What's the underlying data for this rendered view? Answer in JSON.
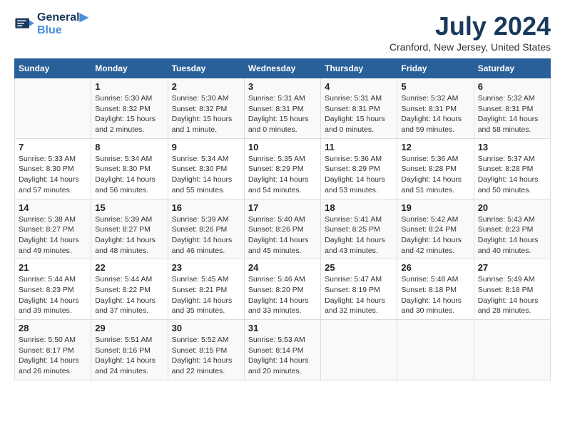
{
  "header": {
    "logo_line1": "General",
    "logo_line2": "Blue",
    "month_year": "July 2024",
    "location": "Cranford, New Jersey, United States"
  },
  "weekdays": [
    "Sunday",
    "Monday",
    "Tuesday",
    "Wednesday",
    "Thursday",
    "Friday",
    "Saturday"
  ],
  "weeks": [
    [
      {
        "day": "",
        "info": ""
      },
      {
        "day": "1",
        "info": "Sunrise: 5:30 AM\nSunset: 8:32 PM\nDaylight: 15 hours\nand 2 minutes."
      },
      {
        "day": "2",
        "info": "Sunrise: 5:30 AM\nSunset: 8:32 PM\nDaylight: 15 hours\nand 1 minute."
      },
      {
        "day": "3",
        "info": "Sunrise: 5:31 AM\nSunset: 8:31 PM\nDaylight: 15 hours\nand 0 minutes."
      },
      {
        "day": "4",
        "info": "Sunrise: 5:31 AM\nSunset: 8:31 PM\nDaylight: 15 hours\nand 0 minutes."
      },
      {
        "day": "5",
        "info": "Sunrise: 5:32 AM\nSunset: 8:31 PM\nDaylight: 14 hours\nand 59 minutes."
      },
      {
        "day": "6",
        "info": "Sunrise: 5:32 AM\nSunset: 8:31 PM\nDaylight: 14 hours\nand 58 minutes."
      }
    ],
    [
      {
        "day": "7",
        "info": "Sunrise: 5:33 AM\nSunset: 8:30 PM\nDaylight: 14 hours\nand 57 minutes."
      },
      {
        "day": "8",
        "info": "Sunrise: 5:34 AM\nSunset: 8:30 PM\nDaylight: 14 hours\nand 56 minutes."
      },
      {
        "day": "9",
        "info": "Sunrise: 5:34 AM\nSunset: 8:30 PM\nDaylight: 14 hours\nand 55 minutes."
      },
      {
        "day": "10",
        "info": "Sunrise: 5:35 AM\nSunset: 8:29 PM\nDaylight: 14 hours\nand 54 minutes."
      },
      {
        "day": "11",
        "info": "Sunrise: 5:36 AM\nSunset: 8:29 PM\nDaylight: 14 hours\nand 53 minutes."
      },
      {
        "day": "12",
        "info": "Sunrise: 5:36 AM\nSunset: 8:28 PM\nDaylight: 14 hours\nand 51 minutes."
      },
      {
        "day": "13",
        "info": "Sunrise: 5:37 AM\nSunset: 8:28 PM\nDaylight: 14 hours\nand 50 minutes."
      }
    ],
    [
      {
        "day": "14",
        "info": "Sunrise: 5:38 AM\nSunset: 8:27 PM\nDaylight: 14 hours\nand 49 minutes."
      },
      {
        "day": "15",
        "info": "Sunrise: 5:39 AM\nSunset: 8:27 PM\nDaylight: 14 hours\nand 48 minutes."
      },
      {
        "day": "16",
        "info": "Sunrise: 5:39 AM\nSunset: 8:26 PM\nDaylight: 14 hours\nand 46 minutes."
      },
      {
        "day": "17",
        "info": "Sunrise: 5:40 AM\nSunset: 8:26 PM\nDaylight: 14 hours\nand 45 minutes."
      },
      {
        "day": "18",
        "info": "Sunrise: 5:41 AM\nSunset: 8:25 PM\nDaylight: 14 hours\nand 43 minutes."
      },
      {
        "day": "19",
        "info": "Sunrise: 5:42 AM\nSunset: 8:24 PM\nDaylight: 14 hours\nand 42 minutes."
      },
      {
        "day": "20",
        "info": "Sunrise: 5:43 AM\nSunset: 8:23 PM\nDaylight: 14 hours\nand 40 minutes."
      }
    ],
    [
      {
        "day": "21",
        "info": "Sunrise: 5:44 AM\nSunset: 8:23 PM\nDaylight: 14 hours\nand 39 minutes."
      },
      {
        "day": "22",
        "info": "Sunrise: 5:44 AM\nSunset: 8:22 PM\nDaylight: 14 hours\nand 37 minutes."
      },
      {
        "day": "23",
        "info": "Sunrise: 5:45 AM\nSunset: 8:21 PM\nDaylight: 14 hours\nand 35 minutes."
      },
      {
        "day": "24",
        "info": "Sunrise: 5:46 AM\nSunset: 8:20 PM\nDaylight: 14 hours\nand 33 minutes."
      },
      {
        "day": "25",
        "info": "Sunrise: 5:47 AM\nSunset: 8:19 PM\nDaylight: 14 hours\nand 32 minutes."
      },
      {
        "day": "26",
        "info": "Sunrise: 5:48 AM\nSunset: 8:18 PM\nDaylight: 14 hours\nand 30 minutes."
      },
      {
        "day": "27",
        "info": "Sunrise: 5:49 AM\nSunset: 8:18 PM\nDaylight: 14 hours\nand 28 minutes."
      }
    ],
    [
      {
        "day": "28",
        "info": "Sunrise: 5:50 AM\nSunset: 8:17 PM\nDaylight: 14 hours\nand 26 minutes."
      },
      {
        "day": "29",
        "info": "Sunrise: 5:51 AM\nSunset: 8:16 PM\nDaylight: 14 hours\nand 24 minutes."
      },
      {
        "day": "30",
        "info": "Sunrise: 5:52 AM\nSunset: 8:15 PM\nDaylight: 14 hours\nand 22 minutes."
      },
      {
        "day": "31",
        "info": "Sunrise: 5:53 AM\nSunset: 8:14 PM\nDaylight: 14 hours\nand 20 minutes."
      },
      {
        "day": "",
        "info": ""
      },
      {
        "day": "",
        "info": ""
      },
      {
        "day": "",
        "info": ""
      }
    ]
  ]
}
